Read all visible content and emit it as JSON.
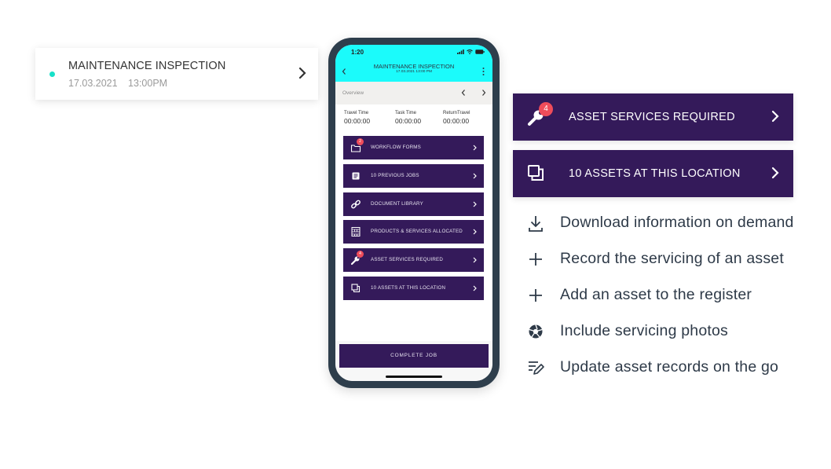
{
  "job_card": {
    "title": "MAINTENANCE INSPECTION",
    "date": "17.03.2021",
    "time": "13:00PM",
    "status_color": "#17e0c8"
  },
  "phone": {
    "status_time": "1:20",
    "header": {
      "title": "MAINTENANCE INSPECTION",
      "subtitle": "17.03.2021   13:00 PM",
      "color": "#1bfbfb"
    },
    "overview_label": "Overview",
    "times": [
      {
        "label": "Travel Time",
        "value": "00:00:00"
      },
      {
        "label": "Task Time",
        "value": "00:00:00"
      },
      {
        "label": "ReturnTravel",
        "value": "00:00:00"
      }
    ],
    "menu": [
      {
        "label": "WORKFLOW FORMS",
        "icon": "folder-icon",
        "badge": "2"
      },
      {
        "label": "10 PREVIOUS JOBS",
        "icon": "document-icon",
        "badge": null
      },
      {
        "label": "DOCUMENT LIBRARY",
        "icon": "link-icon",
        "badge": null
      },
      {
        "label": "PRODUCTS & SERVICES ALLOCATED",
        "icon": "cabinet-icon",
        "badge": null
      },
      {
        "label": "ASSET SERVICES REQUIRED",
        "icon": "wrench-icon",
        "badge": "4"
      },
      {
        "label": "10 ASSETS AT THIS LOCATION",
        "icon": "copy-icon",
        "badge": null
      }
    ],
    "complete_label": "COMPLETE JOB",
    "accent": "#341a5a"
  },
  "highlight_buttons": [
    {
      "label": "ASSET SERVICES REQUIRED",
      "icon": "wrench-icon",
      "badge": "4"
    },
    {
      "label": "10 ASSETS AT THIS LOCATION",
      "icon": "copy-icon"
    }
  ],
  "features": [
    {
      "label": "Download information on demand",
      "icon": "download-icon"
    },
    {
      "label": "Record the servicing of an asset",
      "icon": "plus-icon"
    },
    {
      "label": "Add an asset to the register",
      "icon": "plus-icon"
    },
    {
      "label": "Include servicing photos",
      "icon": "aperture-icon"
    },
    {
      "label": "Update asset records on the go",
      "icon": "edit-list-icon"
    }
  ]
}
